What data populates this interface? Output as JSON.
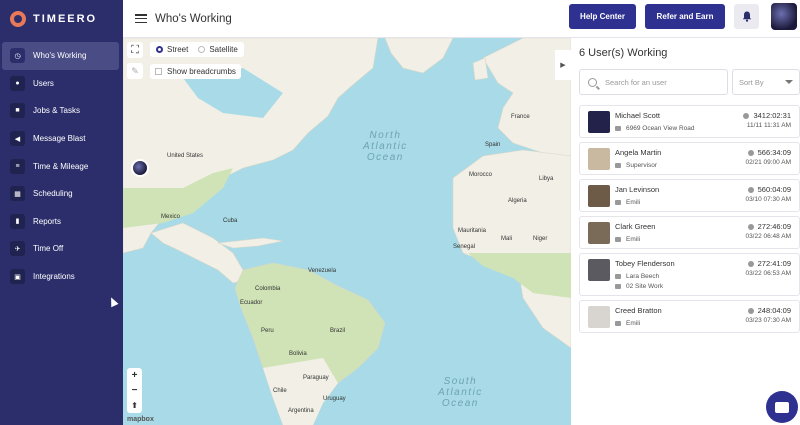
{
  "app": {
    "brand": "TIMEERO"
  },
  "sidebar": {
    "items": [
      {
        "label": "Who's Working",
        "icon": "clock-icon",
        "active": true
      },
      {
        "label": "Users",
        "icon": "users-icon",
        "active": false
      },
      {
        "label": "Jobs & Tasks",
        "icon": "briefcase-icon",
        "active": false
      },
      {
        "label": "Message Blast",
        "icon": "megaphone-icon",
        "active": false
      },
      {
        "label": "Time & Mileage",
        "icon": "timesheet-icon",
        "active": false
      },
      {
        "label": "Scheduling",
        "icon": "calendar-icon",
        "active": false
      },
      {
        "label": "Reports",
        "icon": "chart-icon",
        "active": false
      },
      {
        "label": "Time Off",
        "icon": "plane-icon",
        "active": false
      },
      {
        "label": "Integrations",
        "icon": "puzzle-icon",
        "active": false
      }
    ]
  },
  "header": {
    "title": "Who's Working",
    "help_label": "Help Center",
    "refer_label": "Refer and Earn"
  },
  "map": {
    "layer_street": "Street",
    "layer_satellite": "Satellite",
    "selected_layer": "Street",
    "breadcrumbs_label": "Show breadcrumbs",
    "breadcrumbs_checked": false,
    "attribution": "mapbox",
    "labels": {
      "north_atlantic": [
        "North",
        "Atlantic",
        "Ocean"
      ],
      "south_atlantic": [
        "South",
        "Atlantic",
        "Ocean"
      ],
      "united_states": "United States",
      "mexico": "Mexico",
      "cuba": "Cuba",
      "venezuela": "Venezuela",
      "colombia": "Colombia",
      "ecuador": "Ecuador",
      "peru": "Peru",
      "brazil": "Brazil",
      "bolivia": "Bolivia",
      "paraguay": "Paraguay",
      "chile": "Chile",
      "uruguay": "Uruguay",
      "argentina": "Argentina",
      "france": "France",
      "spain": "Spain",
      "morocco": "Morocco",
      "algeria": "Algeria",
      "libya": "Libya",
      "mauritania": "Mauritania",
      "mali": "Mali",
      "niger": "Niger",
      "senegal": "Senegal"
    }
  },
  "panel": {
    "title": "6 User(s) Working",
    "search_placeholder": "Search for an user",
    "sort_placeholder": "Sort By",
    "users": [
      {
        "name": "Michael Scott",
        "subs": [
          "6969 Ocean View Road"
        ],
        "duration": "3412:02:31",
        "date": "11/11 11:31 AM",
        "avatar_color": "#23224a"
      },
      {
        "name": "Angela Martin",
        "subs": [
          "Supervisor"
        ],
        "duration": "566:34:09",
        "date": "02/21 09:00 AM",
        "avatar_color": "#c9b9a0"
      },
      {
        "name": "Jan Levinson",
        "subs": [
          "Emili"
        ],
        "duration": "560:04:09",
        "date": "03/10 07:30 AM",
        "avatar_color": "#6e5b47"
      },
      {
        "name": "Clark Green",
        "subs": [
          "Emili"
        ],
        "duration": "272:46:09",
        "date": "03/22 06:48 AM",
        "avatar_color": "#7a6a58"
      },
      {
        "name": "Tobey Flenderson",
        "subs": [
          "Lara Beech",
          "02 Site Work"
        ],
        "duration": "272:41:09",
        "date": "03/22 06:53 AM",
        "avatar_color": "#5a5a60"
      },
      {
        "name": "Creed Bratton",
        "subs": [
          "Emili"
        ],
        "duration": "248:04:09",
        "date": "03/23 07:30 AM",
        "avatar_color": "#d8d4d0"
      }
    ]
  },
  "colors": {
    "sidebar": "#2b2e6b",
    "accent": "#2f3190",
    "water": "#a8dbe7",
    "land": "#f2f0e6",
    "forest": "#cfe3b6"
  }
}
